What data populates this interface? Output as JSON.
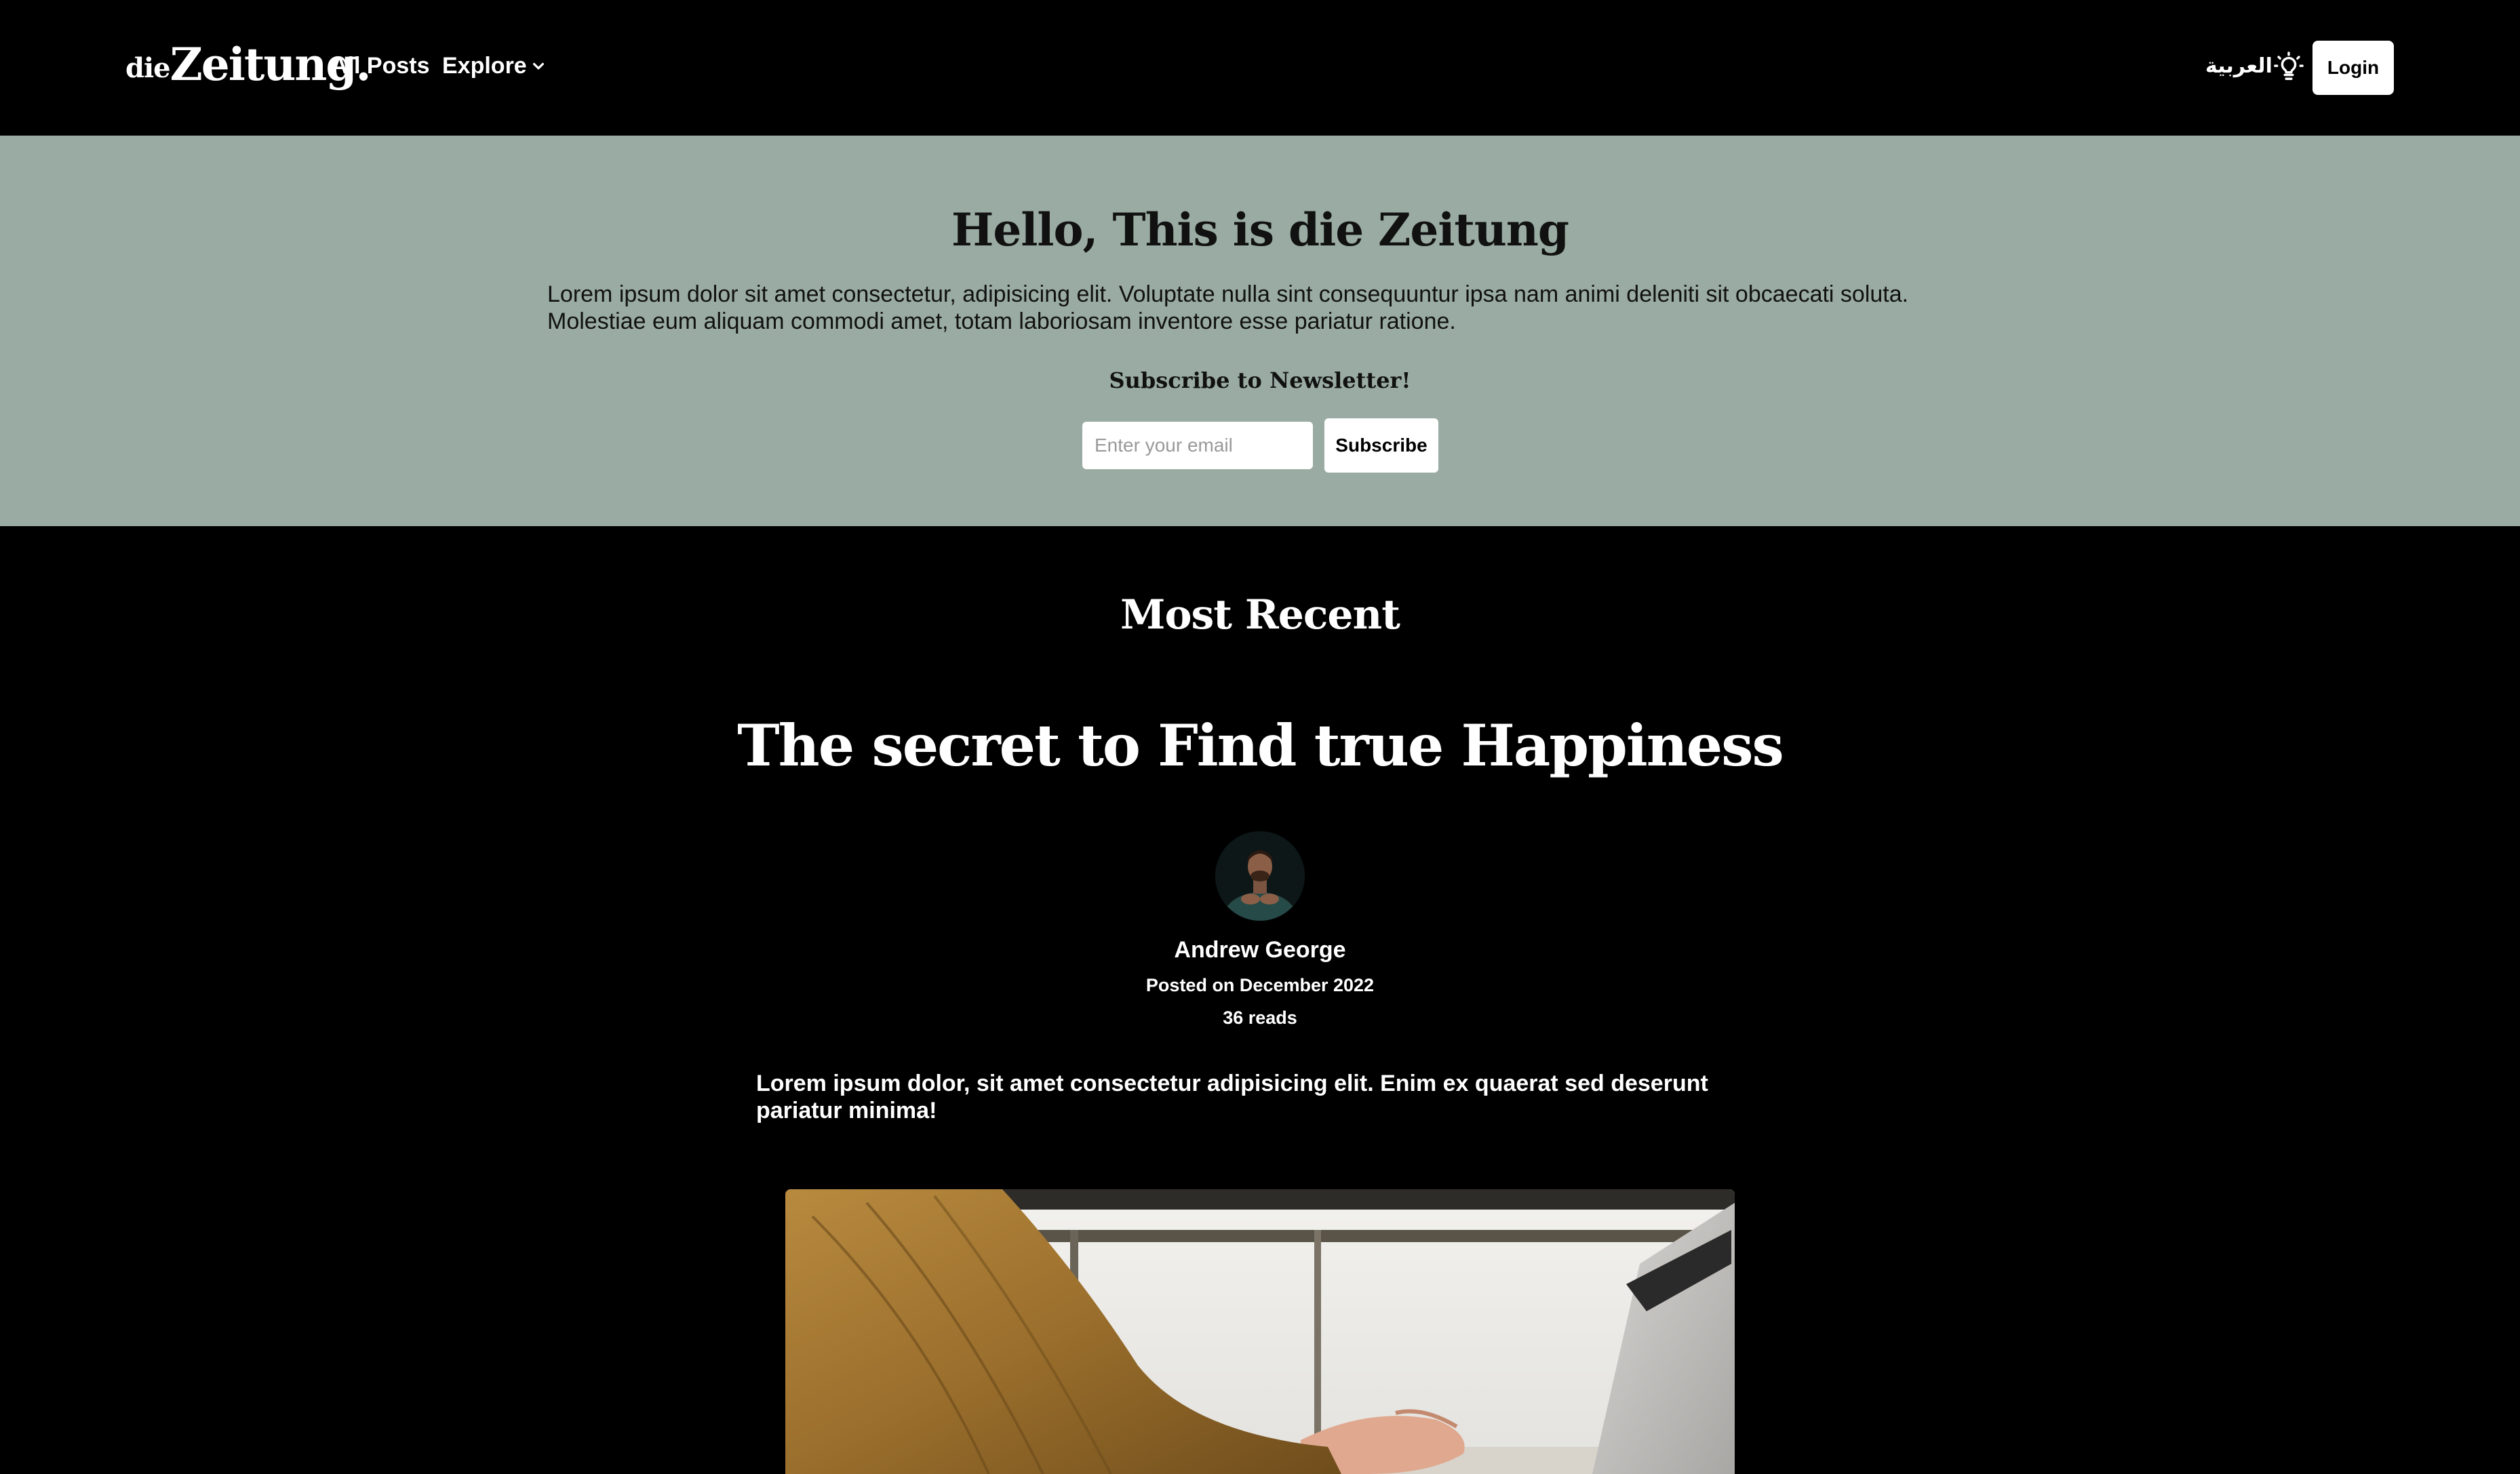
{
  "nav": {
    "logo_prefix": "die",
    "logo_main": "Zeitung.",
    "all_posts": "All Posts",
    "explore": "Explore",
    "language": "العربية",
    "login": "Login",
    "theme_icon": "lightbulb-icon",
    "explore_icon": "chevron-down-icon"
  },
  "hero": {
    "title": "Hello, This is die Zeitung",
    "text": "Lorem ipsum dolor sit amet consectetur, adipisicing elit. Voluptate nulla sint consequuntur ipsa nam animi deleniti sit obcaecati soluta. Molestiae eum aliquam commodi amet, totam laboriosam inventore esse pariatur ratione.",
    "newsletter_label": "Subscribe to Newsletter!",
    "email_placeholder": "Enter your email",
    "email_value": "",
    "subscribe": "Subscribe",
    "background": "#99aba3"
  },
  "recent": {
    "section_title": "Most Recent",
    "post": {
      "title": "The secret to Find true Happiness",
      "author": "Andrew George",
      "posted": "Posted on December 2022",
      "reads": "36 reads",
      "excerpt": "Lorem ipsum dolor, sit amet consectetur adipisicing elit. Enim ex quaerat sed deserunt pariatur minima!"
    }
  }
}
